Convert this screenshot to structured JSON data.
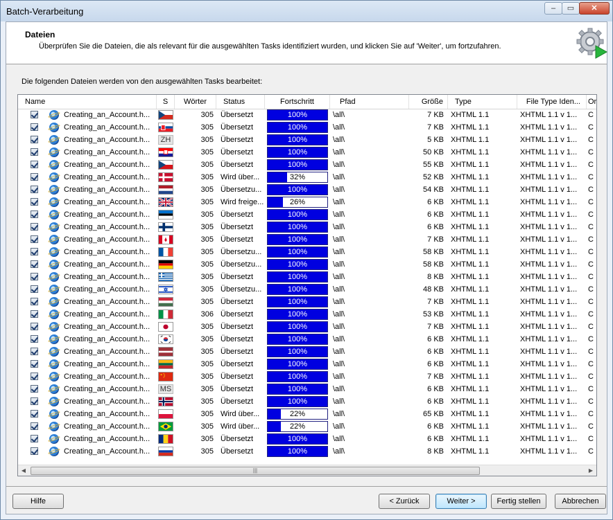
{
  "window": {
    "title": "Batch-Verarbeitung"
  },
  "header": {
    "title": "Dateien",
    "description": "Überprüfen Sie die Dateien, die als relevant für die ausgewählten Tasks identifiziert wurden, und klicken Sie auf 'Weiter', um fortzufahren."
  },
  "subtitle": "Die folgenden Dateien werden von den ausgewählten Tasks bearbeitet:",
  "columns": [
    "Name",
    "S",
    "Wörter",
    "Status",
    "Fortschritt",
    "Pfad",
    "Größe",
    "Type",
    "File Type Iden...",
    "Ori"
  ],
  "rows": [
    {
      "name": "Creating_an_Account.h...",
      "flag": "cz-red",
      "words": "305",
      "status": "Übersetzt",
      "progress": 100,
      "progress_label": "100%",
      "path": "\\all\\",
      "size": "7 KB",
      "type": "XHTML 1.1",
      "ftid": "XHTML 1.1 v 1...",
      "ori": "C"
    },
    {
      "name": "Creating_an_Account.h...",
      "flag": "sk",
      "words": "305",
      "status": "Übersetzt",
      "progress": 100,
      "progress_label": "100%",
      "path": "\\all\\",
      "size": "7 KB",
      "type": "XHTML 1.1",
      "ftid": "XHTML 1.1 v 1...",
      "ori": "C"
    },
    {
      "name": "Creating_an_Account.h...",
      "flag": "zh",
      "flag_text": "ZH",
      "words": "305",
      "status": "Übersetzt",
      "progress": 100,
      "progress_label": "100%",
      "path": "\\all\\",
      "size": "5 KB",
      "type": "XHTML 1.1",
      "ftid": "XHTML 1.1 v 1...",
      "ori": "C"
    },
    {
      "name": "Creating_an_Account.h...",
      "flag": "hr",
      "words": "305",
      "status": "Übersetzt",
      "progress": 100,
      "progress_label": "100%",
      "path": "\\all\\",
      "size": "50 KB",
      "type": "XHTML 1.1",
      "ftid": "XHTML 1.1 v 1...",
      "ori": "C"
    },
    {
      "name": "Creating_an_Account.h...",
      "flag": "cz",
      "words": "305",
      "status": "Übersetzt",
      "progress": 100,
      "progress_label": "100%",
      "path": "\\all\\",
      "size": "55 KB",
      "type": "XHTML 1.1",
      "ftid": "XHTML 1.1 v 1...",
      "ori": "C"
    },
    {
      "name": "Creating_an_Account.h...",
      "flag": "dk",
      "words": "305",
      "status": "Wird über...",
      "progress": 32,
      "progress_label": "32%",
      "path": "\\all\\",
      "size": "52 KB",
      "type": "XHTML 1.1",
      "ftid": "XHTML 1.1 v 1...",
      "ori": "C"
    },
    {
      "name": "Creating_an_Account.h...",
      "flag": "nl",
      "words": "305",
      "status": "Übersetzu...",
      "progress": 100,
      "progress_label": "100%",
      "path": "\\all\\",
      "size": "54 KB",
      "type": "XHTML 1.1",
      "ftid": "XHTML 1.1 v 1...",
      "ori": "C"
    },
    {
      "name": "Creating_an_Account.h...",
      "flag": "gb",
      "words": "305",
      "status": "Wird freige...",
      "progress": 26,
      "progress_label": "26%",
      "path": "\\all\\",
      "size": "6 KB",
      "type": "XHTML 1.1",
      "ftid": "XHTML 1.1 v 1...",
      "ori": "C"
    },
    {
      "name": "Creating_an_Account.h...",
      "flag": "ee",
      "words": "305",
      "status": "Übersetzt",
      "progress": 100,
      "progress_label": "100%",
      "path": "\\all\\",
      "size": "6 KB",
      "type": "XHTML 1.1",
      "ftid": "XHTML 1.1 v 1...",
      "ori": "C"
    },
    {
      "name": "Creating_an_Account.h...",
      "flag": "fi",
      "words": "305",
      "status": "Übersetzt",
      "progress": 100,
      "progress_label": "100%",
      "path": "\\all\\",
      "size": "6 KB",
      "type": "XHTML 1.1",
      "ftid": "XHTML 1.1 v 1...",
      "ori": "C"
    },
    {
      "name": "Creating_an_Account.h...",
      "flag": "ca",
      "words": "305",
      "status": "Übersetzt",
      "progress": 100,
      "progress_label": "100%",
      "path": "\\all\\",
      "size": "7 KB",
      "type": "XHTML 1.1",
      "ftid": "XHTML 1.1 v 1...",
      "ori": "C"
    },
    {
      "name": "Creating_an_Account.h...",
      "flag": "fr",
      "words": "305",
      "status": "Übersetzu...",
      "progress": 100,
      "progress_label": "100%",
      "path": "\\all\\",
      "size": "58 KB",
      "type": "XHTML 1.1",
      "ftid": "XHTML 1.1 v 1...",
      "ori": "C"
    },
    {
      "name": "Creating_an_Account.h...",
      "flag": "de",
      "words": "305",
      "status": "Übersetzu...",
      "progress": 100,
      "progress_label": "100%",
      "path": "\\all\\",
      "size": "58 KB",
      "type": "XHTML 1.1",
      "ftid": "XHTML 1.1 v 1...",
      "ori": "C"
    },
    {
      "name": "Creating_an_Account.h...",
      "flag": "gr",
      "words": "305",
      "status": "Übersetzt",
      "progress": 100,
      "progress_label": "100%",
      "path": "\\all\\",
      "size": "8 KB",
      "type": "XHTML 1.1",
      "ftid": "XHTML 1.1 v 1...",
      "ori": "C"
    },
    {
      "name": "Creating_an_Account.h...",
      "flag": "il",
      "words": "305",
      "status": "Übersetzu...",
      "progress": 100,
      "progress_label": "100%",
      "path": "\\all\\",
      "size": "48 KB",
      "type": "XHTML 1.1",
      "ftid": "XHTML 1.1 v 1...",
      "ori": "C"
    },
    {
      "name": "Creating_an_Account.h...",
      "flag": "hu",
      "words": "305",
      "status": "Übersetzt",
      "progress": 100,
      "progress_label": "100%",
      "path": "\\all\\",
      "size": "7 KB",
      "type": "XHTML 1.1",
      "ftid": "XHTML 1.1 v 1...",
      "ori": "C"
    },
    {
      "name": "Creating_an_Account.h...",
      "flag": "it",
      "words": "306",
      "status": "Übersetzt",
      "progress": 100,
      "progress_label": "100%",
      "path": "\\all\\",
      "size": "53 KB",
      "type": "XHTML 1.1",
      "ftid": "XHTML 1.1 v 1...",
      "ori": "C"
    },
    {
      "name": "Creating_an_Account.h...",
      "flag": "jp",
      "words": "305",
      "status": "Übersetzt",
      "progress": 100,
      "progress_label": "100%",
      "path": "\\all\\",
      "size": "7 KB",
      "type": "XHTML 1.1",
      "ftid": "XHTML 1.1 v 1...",
      "ori": "C"
    },
    {
      "name": "Creating_an_Account.h...",
      "flag": "kr",
      "words": "305",
      "status": "Übersetzt",
      "progress": 100,
      "progress_label": "100%",
      "path": "\\all\\",
      "size": "6 KB",
      "type": "XHTML 1.1",
      "ftid": "XHTML 1.1 v 1...",
      "ori": "C"
    },
    {
      "name": "Creating_an_Account.h...",
      "flag": "lv",
      "words": "305",
      "status": "Übersetzt",
      "progress": 100,
      "progress_label": "100%",
      "path": "\\all\\",
      "size": "6 KB",
      "type": "XHTML 1.1",
      "ftid": "XHTML 1.1 v 1...",
      "ori": "C"
    },
    {
      "name": "Creating_an_Account.h...",
      "flag": "lt",
      "words": "305",
      "status": "Übersetzt",
      "progress": 100,
      "progress_label": "100%",
      "path": "\\all\\",
      "size": "6 KB",
      "type": "XHTML 1.1",
      "ftid": "XHTML 1.1 v 1...",
      "ori": "C"
    },
    {
      "name": "Creating_an_Account.h...",
      "flag": "cn",
      "words": "305",
      "status": "Übersetzt",
      "progress": 100,
      "progress_label": "100%",
      "path": "\\all\\",
      "size": "7 KB",
      "type": "XHTML 1.1",
      "ftid": "XHTML 1.1 v 1...",
      "ori": "C"
    },
    {
      "name": "Creating_an_Account.h...",
      "flag": "ms",
      "flag_text": "MS",
      "words": "305",
      "status": "Übersetzt",
      "progress": 100,
      "progress_label": "100%",
      "path": "\\all\\",
      "size": "6 KB",
      "type": "XHTML 1.1",
      "ftid": "XHTML 1.1 v 1...",
      "ori": "C"
    },
    {
      "name": "Creating_an_Account.h...",
      "flag": "no",
      "words": "305",
      "status": "Übersetzt",
      "progress": 100,
      "progress_label": "100%",
      "path": "\\all\\",
      "size": "6 KB",
      "type": "XHTML 1.1",
      "ftid": "XHTML 1.1 v 1...",
      "ori": "C"
    },
    {
      "name": "Creating_an_Account.h...",
      "flag": "pl",
      "words": "305",
      "status": "Wird über...",
      "progress": 22,
      "progress_label": "22%",
      "path": "\\all\\",
      "size": "65 KB",
      "type": "XHTML 1.1",
      "ftid": "XHTML 1.1 v 1...",
      "ori": "C"
    },
    {
      "name": "Creating_an_Account.h...",
      "flag": "br",
      "words": "305",
      "status": "Wird über...",
      "progress": 22,
      "progress_label": "22%",
      "path": "\\all\\",
      "size": "6 KB",
      "type": "XHTML 1.1",
      "ftid": "XHTML 1.1 v 1...",
      "ori": "C"
    },
    {
      "name": "Creating_an_Account.h...",
      "flag": "ro",
      "words": "305",
      "status": "Übersetzt",
      "progress": 100,
      "progress_label": "100%",
      "path": "\\all\\",
      "size": "6 KB",
      "type": "XHTML 1.1",
      "ftid": "XHTML 1.1 v 1...",
      "ori": "C"
    },
    {
      "name": "Creating_an_Account.h...",
      "flag": "ru",
      "words": "305",
      "status": "Übersetzt",
      "progress": 100,
      "progress_label": "100%",
      "path": "\\all\\",
      "size": "8 KB",
      "type": "XHTML 1.1",
      "ftid": "XHTML 1.1 v 1...",
      "ori": "C"
    }
  ],
  "buttons": {
    "help": "Hilfe",
    "back": "< Zurück",
    "next": "Weiter >",
    "finish": "Fertig stellen",
    "cancel": "Abbrechen"
  },
  "colors": {
    "progress_fill": "#0000e0",
    "accent": "#3c7fb1"
  },
  "icons": {
    "header": "settings-gear-play-icon",
    "file": "ie-html-file-icon"
  }
}
